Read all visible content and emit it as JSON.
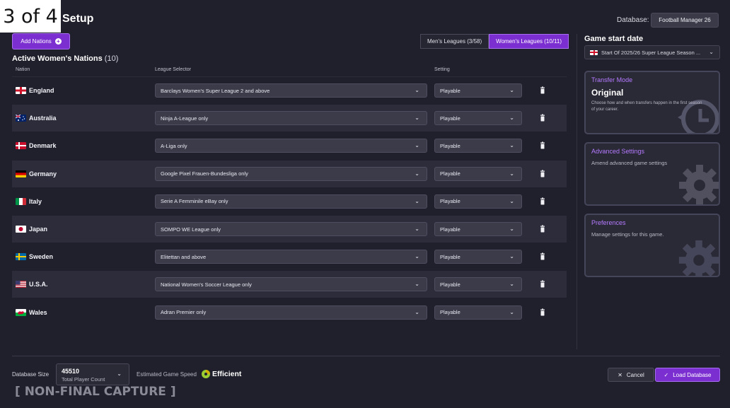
{
  "overlay": {
    "step": "3 of 4"
  },
  "header": {
    "title": "Setup",
    "database_label": "Database:",
    "database_value": "Football Manager 26"
  },
  "toolbar": {
    "add_nations_label": "Add Nations",
    "league_tabs": [
      {
        "label": "Men's Leagues",
        "count": "(3/58)",
        "active": false
      },
      {
        "label": "Women's Leagues",
        "count": "(10/11)",
        "active": true
      }
    ]
  },
  "nations_section": {
    "title": "Active Women's Nations",
    "count": "(10)",
    "columns": {
      "nation": "Nation",
      "league": "League Selector",
      "setting": "Setting"
    },
    "rows": [
      {
        "nation": "England",
        "flag": "flag-england",
        "league": "Barclays Women's Super League 2 and above",
        "setting": "Playable"
      },
      {
        "nation": "Australia",
        "flag": "flag-australia",
        "league": "Ninja A-League only",
        "setting": "Playable"
      },
      {
        "nation": "Denmark",
        "flag": "flag-denmark",
        "league": "A-Liga only",
        "setting": "Playable"
      },
      {
        "nation": "Germany",
        "flag": "flag-germany",
        "league": "Google Pixel Frauen-Bundesliga only",
        "setting": "Playable"
      },
      {
        "nation": "Italy",
        "flag": "flag-italy",
        "league": "Serie A Femminile eBay only",
        "setting": "Playable"
      },
      {
        "nation": "Japan",
        "flag": "flag-japan",
        "league": "SOMPO WE League only",
        "setting": "Playable"
      },
      {
        "nation": "Sweden",
        "flag": "flag-sweden",
        "league": "Elitettan and above",
        "setting": "Playable"
      },
      {
        "nation": "U.S.A.",
        "flag": "flag-usa",
        "league": "National Women's Soccer League only",
        "setting": "Playable"
      },
      {
        "nation": "Wales",
        "flag": "flag-wales",
        "league": "Adran Premier only",
        "setting": "Playable"
      }
    ]
  },
  "sidebar": {
    "game_start_title": "Game start date",
    "game_start_value": "Start Of 2025/26 Super League Season ...",
    "transfer_mode": {
      "title": "Transfer Mode",
      "value": "Original",
      "description": "Choose how and when transfers happen in the first season of your career."
    },
    "advanced_settings": {
      "title": "Advanced Settings",
      "description": "Amend advanced game settings"
    },
    "preferences": {
      "title": "Preferences",
      "description": "Manage settings for this game."
    }
  },
  "footer": {
    "db_size_label": "Database Size",
    "db_size_value": "45510",
    "db_size_sub": "Total Player Count",
    "speed_label": "Estimated Game Speed",
    "speed_value": "Efficient",
    "watermark": "[ NON-FINAL CAPTURE ]",
    "cancel_label": "Cancel",
    "load_label": "Load Database"
  },
  "colors": {
    "background": "#20202c",
    "accent": "#7c2fd1",
    "accent_text": "#b47aff"
  }
}
